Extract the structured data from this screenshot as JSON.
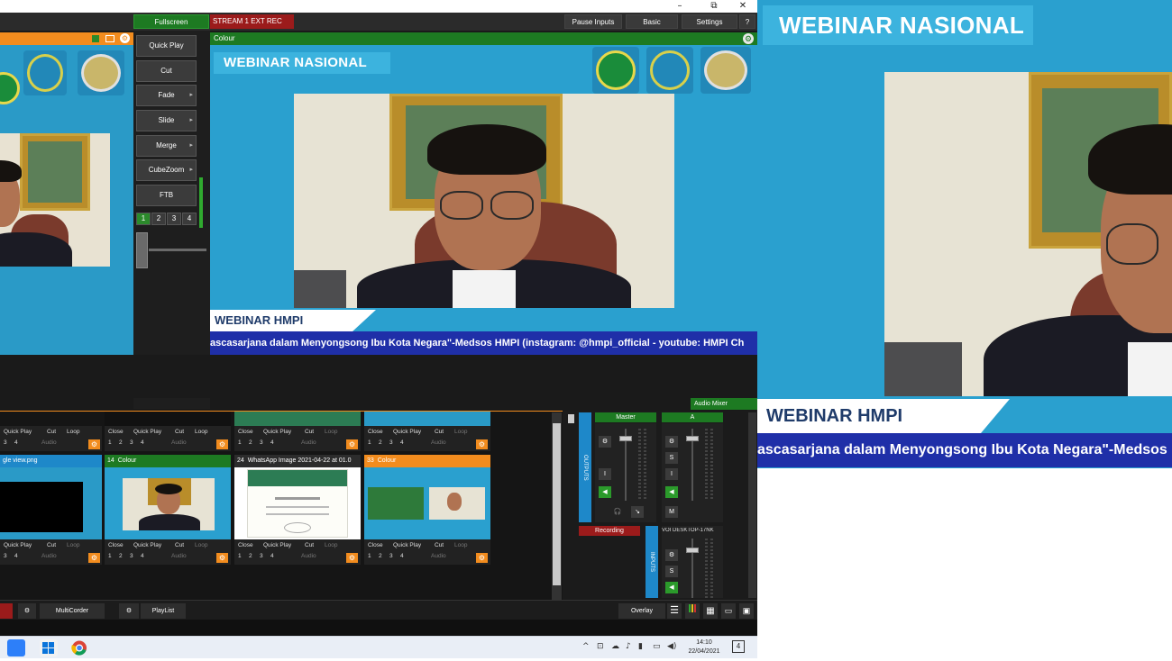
{
  "window_controls": {
    "minimize": "–",
    "maximize": "⧉",
    "close": "✕"
  },
  "menubar": {
    "fullscreen": "Fullscreen",
    "stream_status": "STREAM 1  EXT  REC",
    "pause_inputs": "Pause Inputs",
    "basic": "Basic",
    "settings": "Settings",
    "help": "?"
  },
  "transitions": {
    "quick_play": "Quick Play",
    "cut": "Cut",
    "fade": "Fade",
    "slide": "Slide",
    "merge": "Merge",
    "cubezoom": "CubeZoom",
    "ftb": "FTB",
    "numbers": [
      "1",
      "2",
      "3",
      "4"
    ]
  },
  "output": {
    "header": "Colour",
    "title": "WEBINAR NASIONAL",
    "lower_third": "WEBINAR HMPI",
    "ticker": "ascasarjana dalam Menyongsong Ibu Kota Negara\"-Medsos HMPI (instagram: @hmpi_official - youtube: HMPI Ch"
  },
  "external": {
    "title": "WEBINAR NASIONAL",
    "lower_third": "WEBINAR HMPI",
    "ticker": "ascasarjana dalam Menyongsong Ibu Kota Negara\"-Medsos"
  },
  "inputs": {
    "controls": {
      "close": "Close",
      "quick_play": "Quick Play",
      "cut": "Cut",
      "loop": "Loop",
      "audio": "Audio",
      "nums": [
        "1",
        "2",
        "3",
        "4"
      ]
    },
    "tiles": [
      {
        "number": "",
        "title": "gle view.png",
        "color": "#1e88c9"
      },
      {
        "number": "14",
        "title": "Colour",
        "color": "#1d7a22"
      },
      {
        "number": "24",
        "title": "WhatsApp Image 2021-04-22 at 01.0",
        "color": "#2c2c2c"
      },
      {
        "number": "33",
        "title": "Colour",
        "color": "#f28c1e"
      }
    ]
  },
  "audio": {
    "mixer_label": "Audio Mixer",
    "outputs_label": "OUTPUTS",
    "inputs_label": "INPUTS",
    "master": "Master",
    "bus_a": "A",
    "recording": "Recording",
    "input_channel": "VOI DESKTOP-17NK",
    "btn_s": "S",
    "btn_m": "M",
    "btn_i": "I"
  },
  "bottombar": {
    "multicorder": "MultiCorder",
    "playlist": "PlayList",
    "overlay": "Overlay"
  },
  "taskbar": {
    "time": "14:10",
    "date": "22/04/2021",
    "notifications": "4"
  },
  "colors": {
    "accent_orange": "#f28c1e",
    "active_green": "#1d7a22",
    "stream_red": "#9b1b1b",
    "broadcast_blue": "#2aa0cf",
    "ticker_blue": "#1f2fa8"
  }
}
